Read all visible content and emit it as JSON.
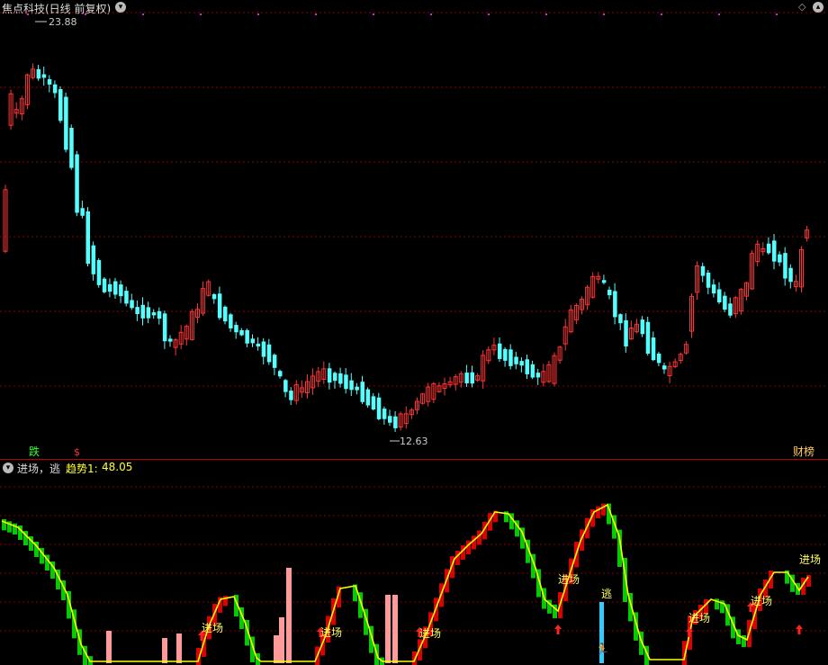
{
  "main_panel": {
    "title": "焦点科技(日线 前复权)",
    "high_label": "23.88",
    "low_label": "12.63",
    "left_marker": "跌",
    "right_marker": "财榜"
  },
  "sub_panel": {
    "formula_label": "进场，逃",
    "trend_label": "趋势1:",
    "trend_value": "48.05",
    "annotations": [
      "进场",
      "进场",
      "进场",
      "进场",
      "逃",
      "进场",
      "进场",
      "进场"
    ]
  },
  "colors": {
    "up": "#ff3333",
    "down": "#54ffff",
    "grid": "#8b0000",
    "trend_line": "#ffff00",
    "green_bar": "#00cc00",
    "red_bar": "#dd0000",
    "pink_bar": "#ff9a9a",
    "label": "#ffff66"
  }
}
